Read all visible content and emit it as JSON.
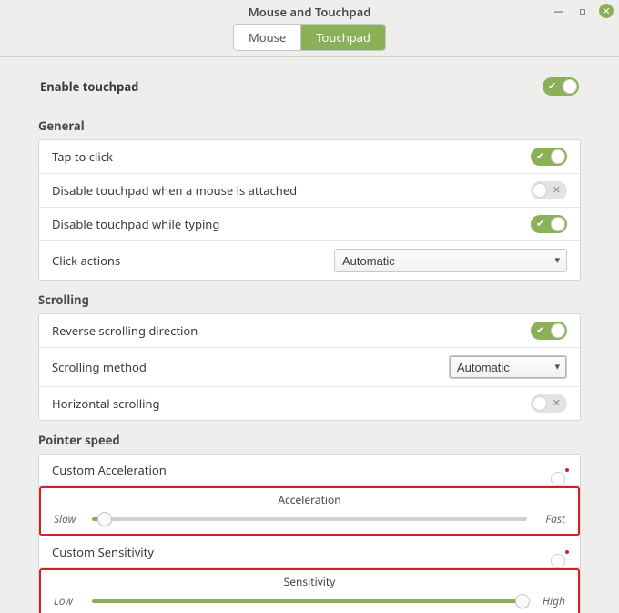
{
  "window": {
    "title": "Mouse and Touchpad"
  },
  "tabs": {
    "mouse": "Mouse",
    "touchpad": "Touchpad",
    "active": "touchpad"
  },
  "enable_row": {
    "label": "Enable touchpad",
    "value": true
  },
  "sections": {
    "general": {
      "title": "General",
      "tap_to_click": {
        "label": "Tap to click",
        "value": true
      },
      "disable_when_mouse": {
        "label": "Disable touchpad when a mouse is attached",
        "value": false
      },
      "disable_typing": {
        "label": "Disable touchpad while typing",
        "value": true
      },
      "click_actions": {
        "label": "Click actions",
        "selected": "Automatic"
      }
    },
    "scrolling": {
      "title": "Scrolling",
      "reverse": {
        "label": "Reverse scrolling direction",
        "value": true
      },
      "method": {
        "label": "Scrolling method",
        "selected": "Automatic"
      },
      "horizontal": {
        "label": "Horizontal scrolling",
        "value": false
      }
    },
    "pointer": {
      "title": "Pointer speed",
      "custom_accel": {
        "label": "Custom Acceleration",
        "value": true
      },
      "accel_slider": {
        "title": "Acceleration",
        "low": "Slow",
        "high": "Fast",
        "value_pct": 3
      },
      "custom_sens": {
        "label": "Custom Sensitivity",
        "value": true
      },
      "sens_slider": {
        "title": "Sensitivity",
        "low": "Low",
        "high": "High",
        "value_pct": 99
      }
    }
  }
}
